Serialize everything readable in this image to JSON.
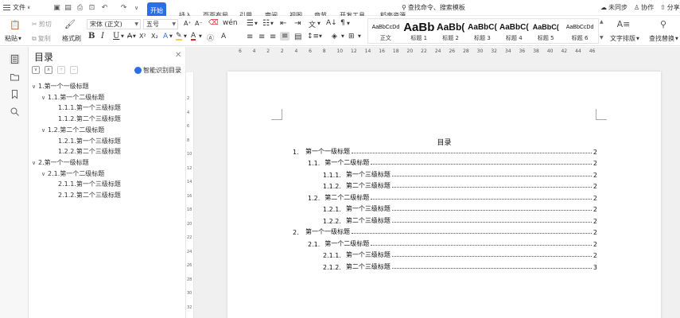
{
  "menubar": {
    "file": "文件",
    "tabs": [
      "开始",
      "插入",
      "页面布局",
      "引用",
      "审阅",
      "视图",
      "章节",
      "开发工具",
      "稻壳资源"
    ],
    "active_tab": "开始",
    "search_placeholder": "查找命令、搜索模板",
    "sync": "未同步",
    "collab": "协作",
    "share": "分享"
  },
  "toolbar": {
    "paste": "粘贴",
    "cut": "剪切",
    "copy": "复制",
    "format_painter": "格式刷",
    "font_name": "宋体 (正文)",
    "font_size": "五号",
    "styles": [
      {
        "sample": "AaBbCcDd",
        "name": "正文"
      },
      {
        "sample": "AaBb",
        "name": "标题 1"
      },
      {
        "sample": "AaBb(",
        "name": "标题 2"
      },
      {
        "sample": "AaBbC(",
        "name": "标题 3"
      },
      {
        "sample": "AaBbC(",
        "name": "标题 4"
      },
      {
        "sample": "AaBbC(",
        "name": "标题 5"
      },
      {
        "sample": "AaBbCcDd",
        "name": "标题 6"
      }
    ],
    "text_layout": "文字排版",
    "find_replace": "查找替换"
  },
  "nav": {
    "title": "目录",
    "smart_toc": "智能识别目录",
    "items": [
      {
        "label": "1.第一个一级标题",
        "level": 1,
        "chevron": true
      },
      {
        "label": "1.1.第一个二级标题",
        "level": 2,
        "chevron": true
      },
      {
        "label": "1.1.1.第一个三级标题",
        "level": 3,
        "chevron": false
      },
      {
        "label": "1.1.2.第二个三级标题",
        "level": 3,
        "chevron": false
      },
      {
        "label": "1.2.第二个二级标题",
        "level": 2,
        "chevron": true
      },
      {
        "label": "1.2.1.第一个三级标题",
        "level": 3,
        "chevron": false
      },
      {
        "label": "1.2.2.第二个三级标题",
        "level": 3,
        "chevron": false
      },
      {
        "label": "2.第一个一级标题",
        "level": 1,
        "chevron": true
      },
      {
        "label": "2.1.第一个二级标题",
        "level": 2,
        "chevron": true
      },
      {
        "label": "2.1.1.第一个三级标题",
        "level": 3,
        "chevron": false
      },
      {
        "label": "2.1.2.第二个三级标题",
        "level": 3,
        "chevron": false
      }
    ]
  },
  "ruler": {
    "h_ticks": [
      "6",
      "4",
      "2",
      "2",
      "4",
      "6",
      "8",
      "10",
      "12",
      "14",
      "16",
      "18",
      "20",
      "22",
      "24",
      "26",
      "28",
      "30",
      "32",
      "34",
      "36",
      "38",
      "40",
      "42",
      "44",
      "46"
    ],
    "v_ticks": [
      "2",
      "4",
      "6",
      "8",
      "10",
      "12",
      "14",
      "16",
      "18",
      "20",
      "22",
      "24",
      "26",
      "28",
      "30",
      "32"
    ]
  },
  "document": {
    "toc_title": "目录",
    "toc": [
      {
        "num": "1.",
        "text": "第一个一级标题",
        "page": "2",
        "level": 1
      },
      {
        "num": "1.1.",
        "text": "第一个二级标题",
        "page": "2",
        "level": 2
      },
      {
        "num": "1.1.1.",
        "text": "第一个三级标题",
        "page": "2",
        "level": 3
      },
      {
        "num": "1.1.2.",
        "text": "第二个三级标题",
        "page": "2",
        "level": 3
      },
      {
        "num": "1.2.",
        "text": "第二个二级标题",
        "page": "2",
        "level": 2
      },
      {
        "num": "1.2.1.",
        "text": "第一个三级标题",
        "page": "2",
        "level": 3
      },
      {
        "num": "1.2.2.",
        "text": "第二个三级标题",
        "page": "2",
        "level": 3
      },
      {
        "num": "2.",
        "text": "第一个一级标题",
        "page": "2",
        "level": 1
      },
      {
        "num": "2.1.",
        "text": "第一个二级标题",
        "page": "2",
        "level": 2
      },
      {
        "num": "2.1.1.",
        "text": "第一个三级标题",
        "page": "2",
        "level": 3
      },
      {
        "num": "2.1.2.",
        "text": "第二个三级标题",
        "page": "3",
        "level": 3
      }
    ]
  },
  "colors": {
    "accent": "#2b6fe6"
  }
}
